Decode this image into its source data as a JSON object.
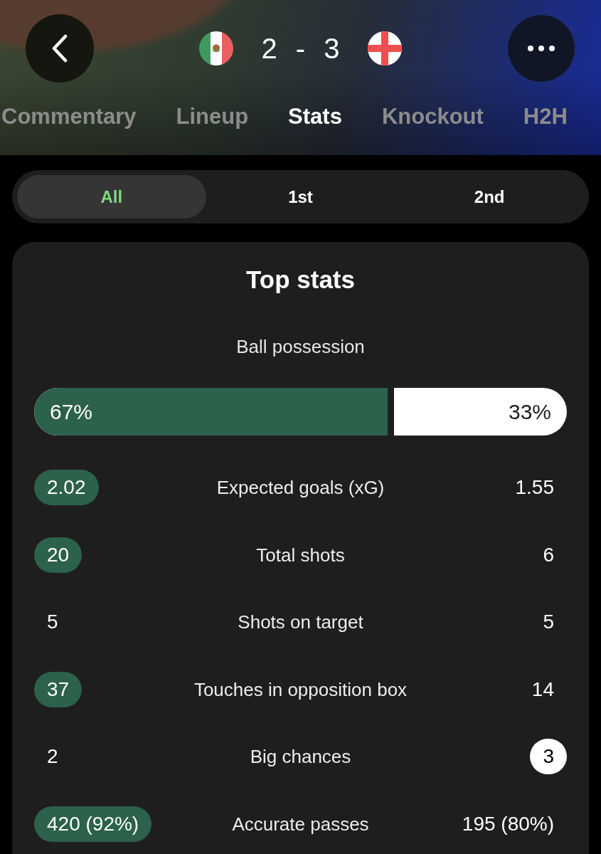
{
  "match": {
    "home_score": "2",
    "separator": "-",
    "away_score": "3"
  },
  "tabs": [
    {
      "label": "Commentary",
      "selected": false
    },
    {
      "label": "Lineup",
      "selected": false
    },
    {
      "label": "Stats",
      "selected": true
    },
    {
      "label": "Knockout",
      "selected": false
    },
    {
      "label": "H2H",
      "selected": false
    }
  ],
  "period_filter": [
    {
      "label": "All",
      "selected": true
    },
    {
      "label": "1st",
      "selected": false
    },
    {
      "label": "2nd",
      "selected": false
    }
  ],
  "top_stats": {
    "title": "Top stats",
    "possession": {
      "label": "Ball possession",
      "level": 0.67,
      "home_reading": "67%",
      "away_reading": "33%"
    },
    "rows": [
      {
        "label": "Expected goals (xG)",
        "home": {
          "value": "2.02",
          "highlighted": true
        },
        "away": {
          "value": "1.55",
          "highlighted": false
        }
      },
      {
        "label": "Total shots",
        "home": {
          "value": "20",
          "highlighted": true
        },
        "away": {
          "value": "6",
          "highlighted": false
        }
      },
      {
        "label": "Shots on target",
        "home": {
          "value": "5",
          "highlighted": false
        },
        "away": {
          "value": "5",
          "highlighted": false
        }
      },
      {
        "label": "Touches in opposition box",
        "home": {
          "value": "37",
          "highlighted": true
        },
        "away": {
          "value": "14",
          "highlighted": false
        }
      },
      {
        "label": "Big chances",
        "home": {
          "value": "2",
          "highlighted": false
        },
        "away": {
          "value": "3",
          "highlighted": true
        }
      },
      {
        "label": "Accurate passes",
        "home": {
          "value": "420 (92%)",
          "highlighted": true
        },
        "away": {
          "value": "195 (80%)",
          "highlighted": false
        }
      }
    ]
  }
}
